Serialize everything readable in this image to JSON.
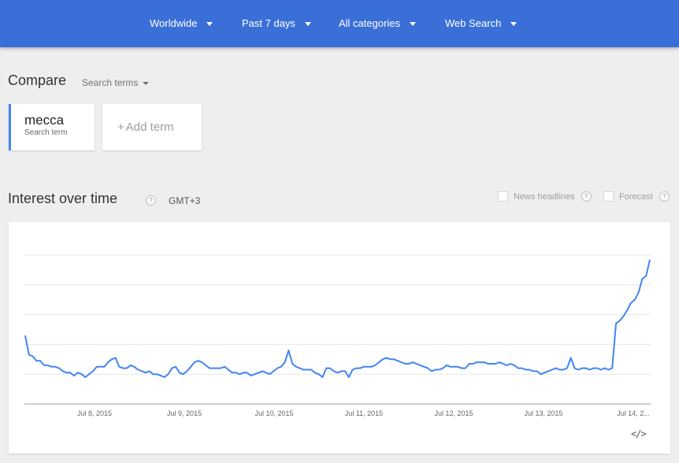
{
  "header": {
    "filters": [
      {
        "label": "Worldwide"
      },
      {
        "label": "Past 7 days"
      },
      {
        "label": "All categories"
      },
      {
        "label": "Web Search"
      }
    ]
  },
  "compare": {
    "title": "Compare",
    "dropdown_label": "Search terms",
    "terms": [
      {
        "name": "mecca",
        "subtitle": "Search term",
        "color": "#4285f4"
      }
    ],
    "add_term_label": "Add term",
    "add_term_icon": "plus"
  },
  "interest_over_time": {
    "title": "Interest over time",
    "help_icon": "?",
    "timezone": "GMT+3",
    "options": [
      {
        "label": "News headlines",
        "checked": false
      },
      {
        "label": "Forecast",
        "checked": false
      }
    ],
    "embed_icon": "</>"
  },
  "chart_data": {
    "type": "line",
    "x_tick_labels": [
      "Jul 8, 2015",
      "Jul 9, 2015",
      "Jul 10, 2015",
      "Jul 11, 2015",
      "Jul 12, 2015",
      "Jul 13, 2015",
      "Jul 14, 2..."
    ],
    "ylim": [
      0,
      100
    ],
    "y_ticks": [
      0,
      20,
      40,
      60,
      80,
      100
    ],
    "y_tick_labels_shown": false,
    "grid": true,
    "series": [
      {
        "color": "#4285f4",
        "values": [
          46,
          33,
          32,
          29,
          29,
          26,
          26,
          25,
          25,
          24,
          22,
          21,
          21,
          19,
          21,
          20,
          18,
          20,
          22,
          25,
          25,
          25,
          28,
          30,
          31,
          25,
          24,
          24,
          26,
          25,
          23,
          22,
          21,
          22,
          20,
          20,
          19,
          18,
          20,
          24,
          25,
          21,
          20,
          22,
          25,
          28,
          29,
          28,
          26,
          24,
          24,
          24,
          24,
          25,
          23,
          21,
          21,
          20,
          21,
          21,
          19,
          20,
          21,
          22,
          21,
          20,
          22,
          24,
          25,
          28,
          36,
          27,
          25,
          24,
          23,
          23,
          23,
          21,
          20,
          18,
          24,
          24,
          22,
          21,
          22,
          22,
          18,
          23,
          24,
          24,
          25,
          25,
          25,
          26,
          28,
          30,
          31,
          30,
          30,
          29,
          28,
          27,
          27,
          28,
          27,
          26,
          25,
          24,
          22,
          23,
          23,
          24,
          26,
          25,
          25,
          25,
          24,
          24,
          27,
          27,
          28,
          28,
          28,
          27,
          27,
          27,
          28,
          27,
          26,
          27,
          26,
          24,
          24,
          23,
          23,
          22,
          22,
          20,
          21,
          22,
          23,
          24,
          23,
          23,
          24,
          31,
          24,
          23,
          24,
          24,
          23,
          24,
          24,
          23,
          24,
          23,
          24,
          54,
          56,
          59,
          63,
          68,
          70,
          75,
          84,
          86,
          97
        ]
      }
    ]
  }
}
